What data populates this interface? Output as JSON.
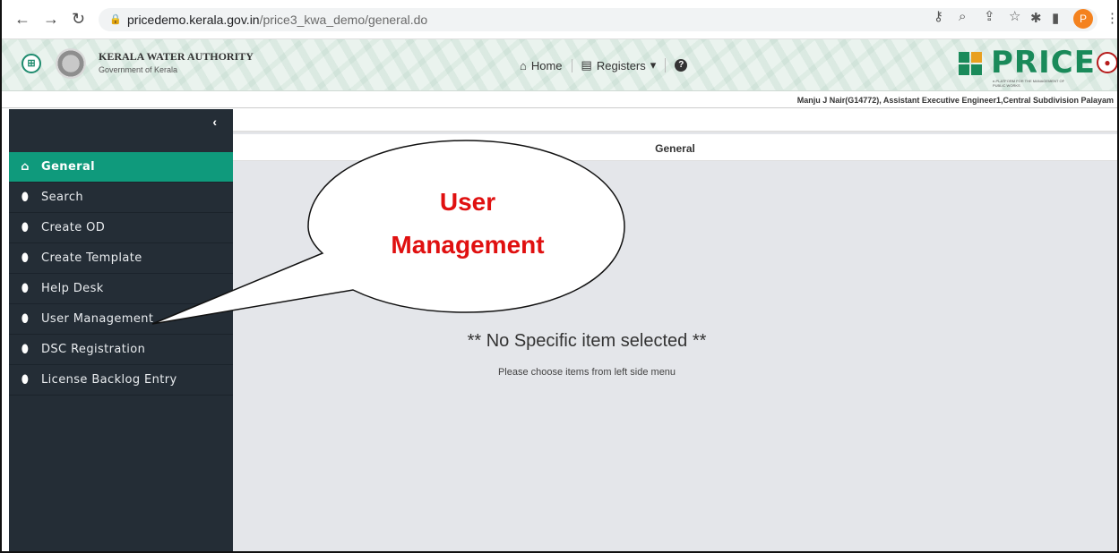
{
  "browser": {
    "url_host": "pricedemo.kerala.gov.in",
    "url_path": "/price3_kwa_demo/general.do",
    "profile_initial": "P"
  },
  "header": {
    "org_name": "KERALA WATER AUTHORITY",
    "org_sub": "Government of Kerala",
    "nav": {
      "home": "Home",
      "registers": "Registers"
    },
    "brand_name": "PRICE",
    "brand_tagline": "e-PLATFORM FOR THE MANAGEMENT OF PUBLIC WORKS"
  },
  "user_line": "Manju J Nair(G14772), Assistant Executive Engineer1,Central Subdivision Palayam",
  "sidebar": {
    "items": [
      {
        "label": "General",
        "active": true
      },
      {
        "label": "Search"
      },
      {
        "label": "Create OD"
      },
      {
        "label": "Create Template"
      },
      {
        "label": "Help Desk"
      },
      {
        "label": "User Management"
      },
      {
        "label": "DSC Registration"
      },
      {
        "label": "License Backlog Entry"
      }
    ]
  },
  "main": {
    "title": "General",
    "empty_title": "** No Specific item selected **",
    "empty_sub": "Please choose items from left side menu"
  },
  "callout": {
    "line1": "User",
    "line2": "Management"
  },
  "colors": {
    "accent": "#0f9a7c",
    "sidebar": "#242d36",
    "callout_text": "#e01010"
  }
}
